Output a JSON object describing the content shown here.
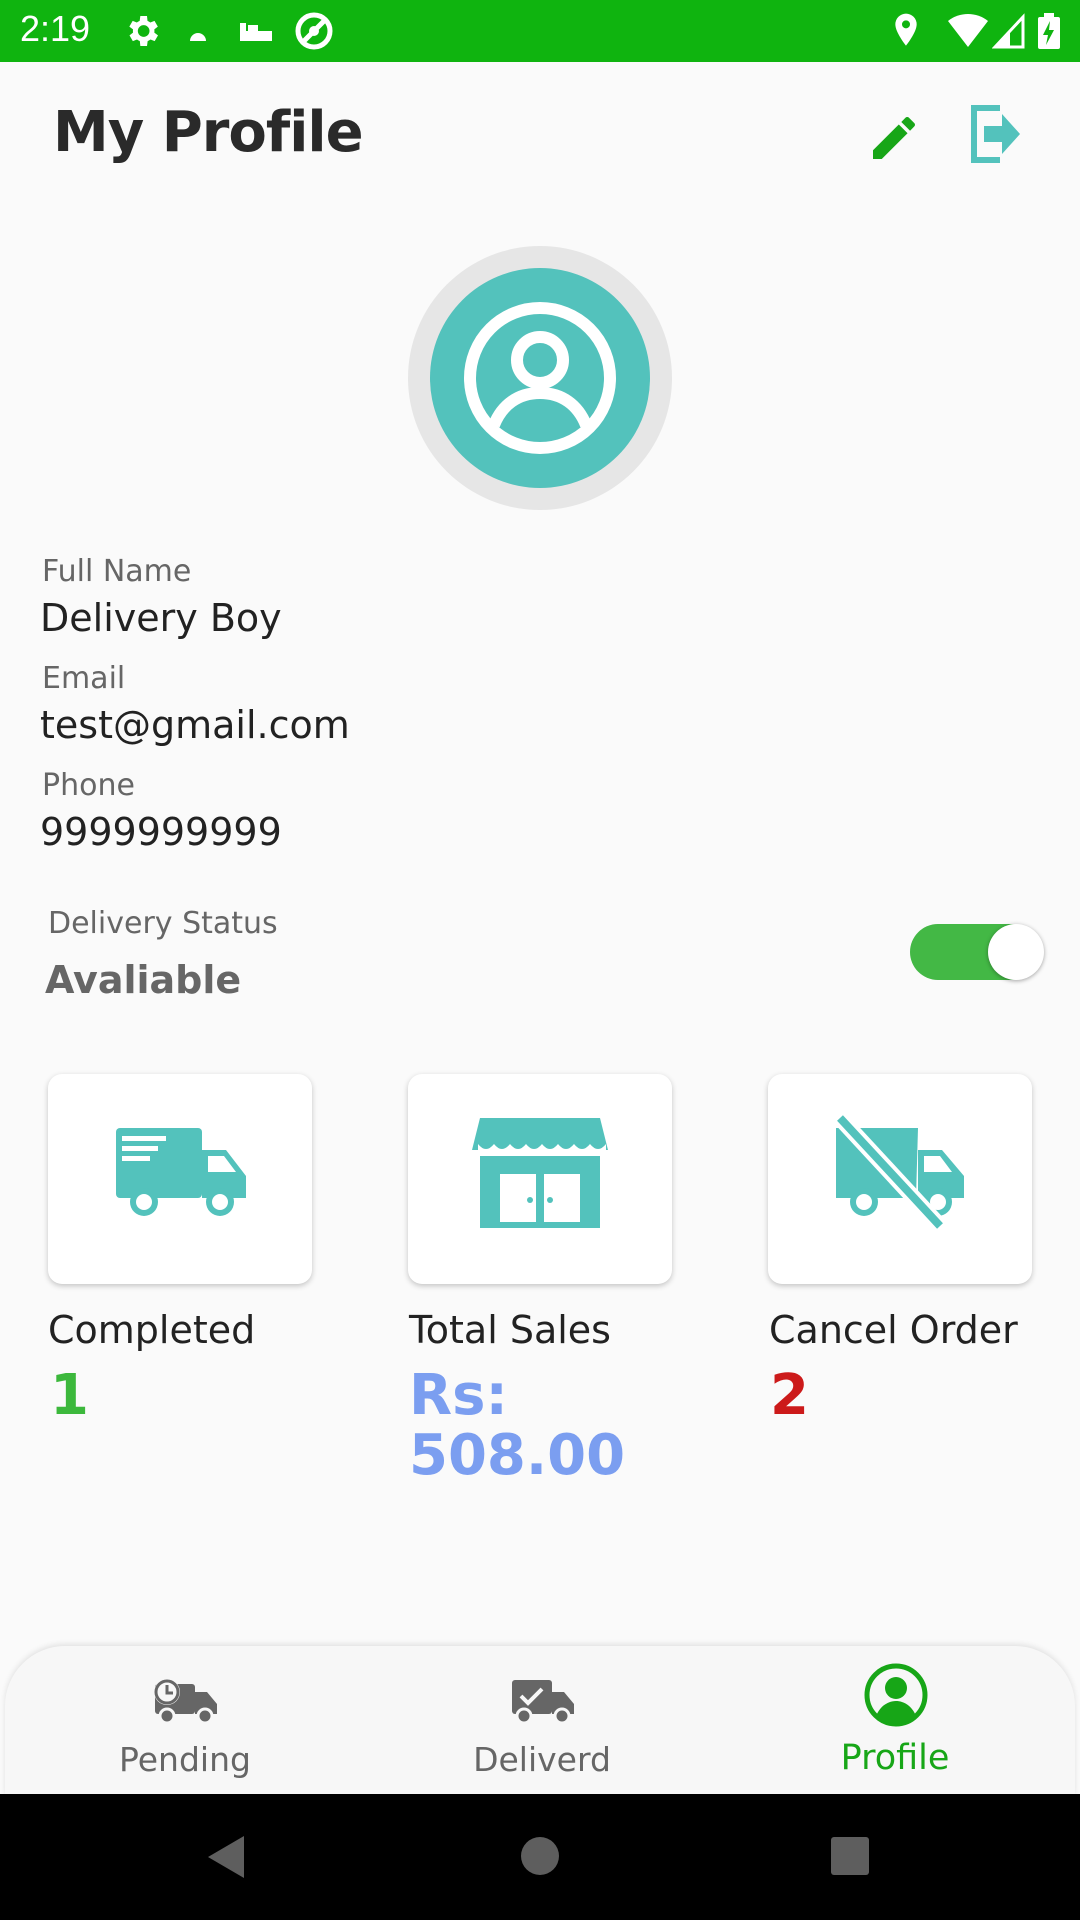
{
  "status_bar": {
    "time": "2:19",
    "background": "#0fb40f",
    "left_icons": [
      "gear-icon",
      "cloud-icon",
      "bed-icon",
      "at-icon"
    ],
    "right_icons": [
      "location-icon",
      "wifi-icon",
      "signal-icon",
      "battery-charging-icon"
    ]
  },
  "header": {
    "title": "My Profile",
    "edit_icon": "pencil-icon",
    "logout_icon": "logout-icon"
  },
  "profile": {
    "avatar_icon": "user-circle-icon",
    "full_name_label": "Full Name",
    "full_name": "Delivery Boy",
    "email_label": "Email",
    "email": "test@gmail.com",
    "phone_label": "Phone",
    "phone": "9999999999"
  },
  "delivery_status": {
    "label": "Delivery Status",
    "value": "Avaliable",
    "toggle_on": true
  },
  "stats": [
    {
      "icon": "delivery-truck-icon",
      "label": "Completed",
      "value": "1",
      "color": "#3cb83c"
    },
    {
      "icon": "store-icon",
      "label": "Total Sales",
      "value": "Rs: 508.00",
      "color": "#7b9ef0"
    },
    {
      "icon": "cancelled-truck-icon",
      "label": "Cancel Order",
      "value": "2",
      "color": "#cc1a1a"
    }
  ],
  "bottom_nav": [
    {
      "icon": "pending-truck-icon",
      "label": "Pending",
      "active": false
    },
    {
      "icon": "delivered-truck-icon",
      "label": "Deliverd",
      "active": false
    },
    {
      "icon": "profile-icon",
      "label": "Profile",
      "active": true
    }
  ],
  "colors": {
    "accent": "#0fb40f",
    "teal": "#53c2bc",
    "toggle": "#43b845",
    "inactive_nav": "#666666",
    "active_nav": "#17a617"
  },
  "system_nav": [
    "back-icon",
    "home-icon",
    "recents-icon"
  ]
}
